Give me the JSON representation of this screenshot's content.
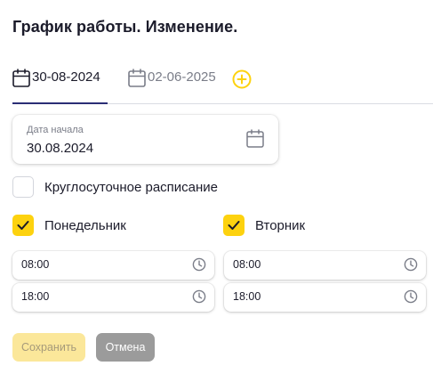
{
  "page": {
    "title": "График работы. Изменение."
  },
  "tabs": [
    {
      "label": "30-08-2024",
      "icon": "calendar-icon",
      "active": true
    },
    {
      "label": "02-06-2025",
      "icon": "calendar-icon",
      "active": false
    }
  ],
  "add_tab": {
    "icon": "plus-circle-icon",
    "color": "#fdd20f"
  },
  "start_date": {
    "label": "Дата начала",
    "value": "30.08.2024",
    "icon": "calendar-icon"
  },
  "round_the_clock": {
    "label": "Круглосуточное расписание",
    "checked": false
  },
  "days": [
    {
      "label": "Понедельник",
      "checked": true,
      "from": "08:00",
      "to": "18:00"
    },
    {
      "label": "Вторник",
      "checked": true,
      "from": "08:00",
      "to": "18:00"
    }
  ],
  "actions": {
    "save_label": "Сохранить",
    "cancel_label": "Отмена"
  },
  "colors": {
    "accent": "#fdd20f",
    "active_tab_underline": "#2b2e75",
    "save_disabled": "#fbe79a",
    "cancel": "#9b9b9b"
  }
}
